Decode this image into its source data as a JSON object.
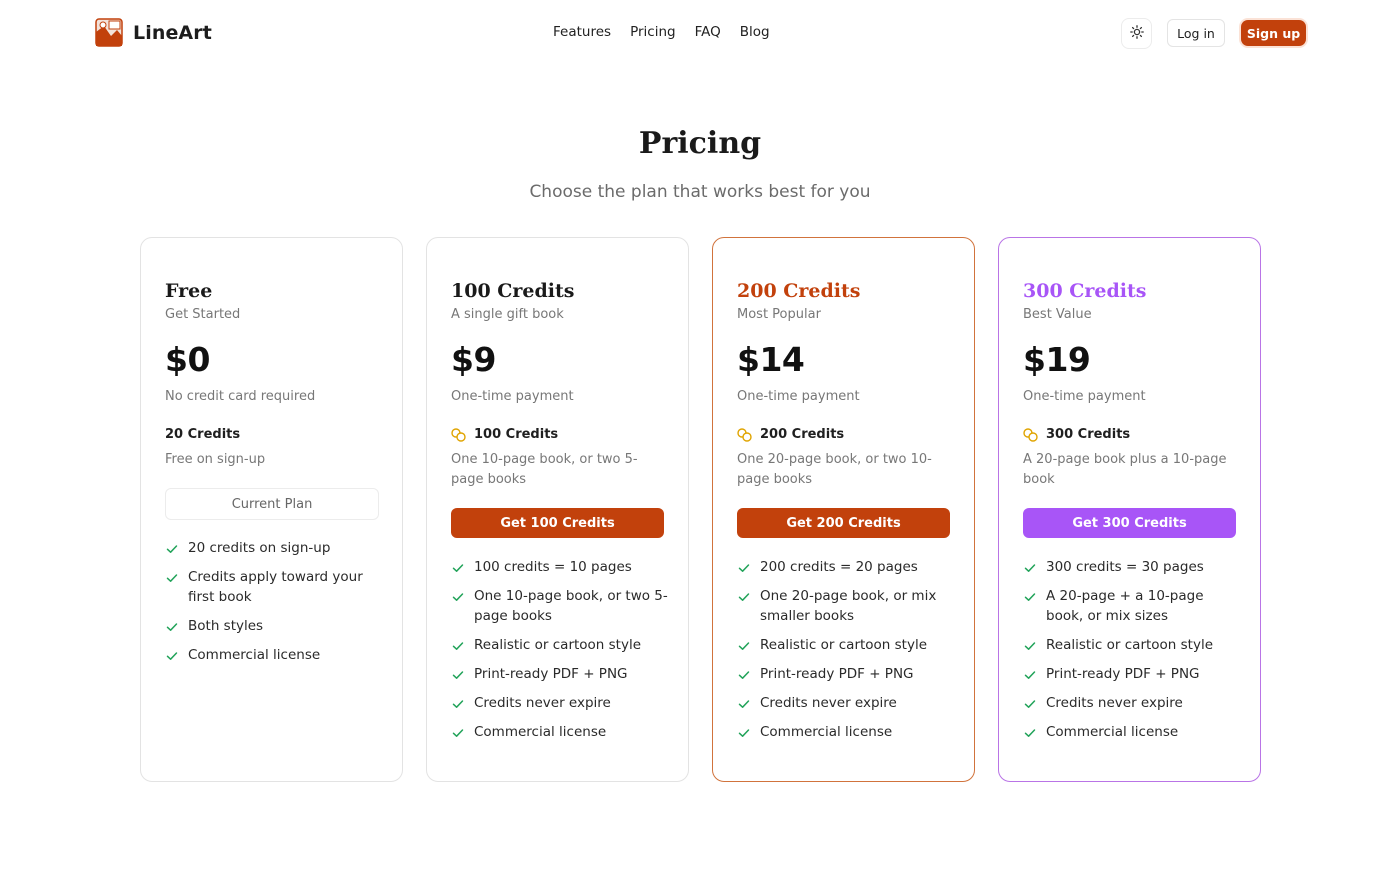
{
  "brand": {
    "name": "LineArt",
    "logo_icon": "picture-frame-icon"
  },
  "nav": {
    "items": [
      "Features",
      "Pricing",
      "FAQ",
      "Blog"
    ]
  },
  "header": {
    "theme_icon": "sun-icon",
    "login": "Log in",
    "signup": "Sign up"
  },
  "page": {
    "title": "Pricing",
    "subtitle": "Choose the plan that works best for you"
  },
  "colors": {
    "accent": "#c2410c",
    "purple": "#a855f7",
    "check": "#22a35a"
  },
  "plans": [
    {
      "name": "Free",
      "tag": "Get Started",
      "price": "$0",
      "price_note": "No credit card required",
      "credits_title": "20 Credits",
      "credits_desc": "Free on sign-up",
      "button": "Current Plan",
      "features": [
        "20 credits on sign-up",
        "Credits apply toward your first book",
        "Both styles",
        "Commercial license"
      ]
    },
    {
      "name": "100 Credits",
      "tag": "A single gift book",
      "price": "$9",
      "price_note": "One-time payment",
      "credits_title": "100 Credits",
      "credits_desc": "One 10-page book, or two 5-page books",
      "button": "Get 100 Credits",
      "features": [
        "100 credits = 10 pages",
        "One 10-page book, or two 5-page books",
        "Realistic or cartoon style",
        "Print-ready PDF + PNG",
        "Credits never expire",
        "Commercial license"
      ]
    },
    {
      "name": "200 Credits",
      "tag": "Most Popular",
      "price": "$14",
      "price_note": "One-time payment",
      "credits_title": "200 Credits",
      "credits_desc": "One 20-page book, or two 10-page books",
      "button": "Get 200 Credits",
      "features": [
        "200 credits = 20 pages",
        "One 20-page book, or mix smaller books",
        "Realistic or cartoon style",
        "Print-ready PDF + PNG",
        "Credits never expire",
        "Commercial license"
      ]
    },
    {
      "name": "300 Credits",
      "tag": "Best Value",
      "price": "$19",
      "price_note": "One-time payment",
      "credits_title": "300 Credits",
      "credits_desc": "A 20-page book plus a 10-page book",
      "button": "Get 300 Credits",
      "features": [
        "300 credits = 30 pages",
        "A 20-page + a 10-page book, or mix sizes",
        "Realistic or cartoon style",
        "Print-ready PDF + PNG",
        "Credits never expire",
        "Commercial license"
      ]
    }
  ]
}
